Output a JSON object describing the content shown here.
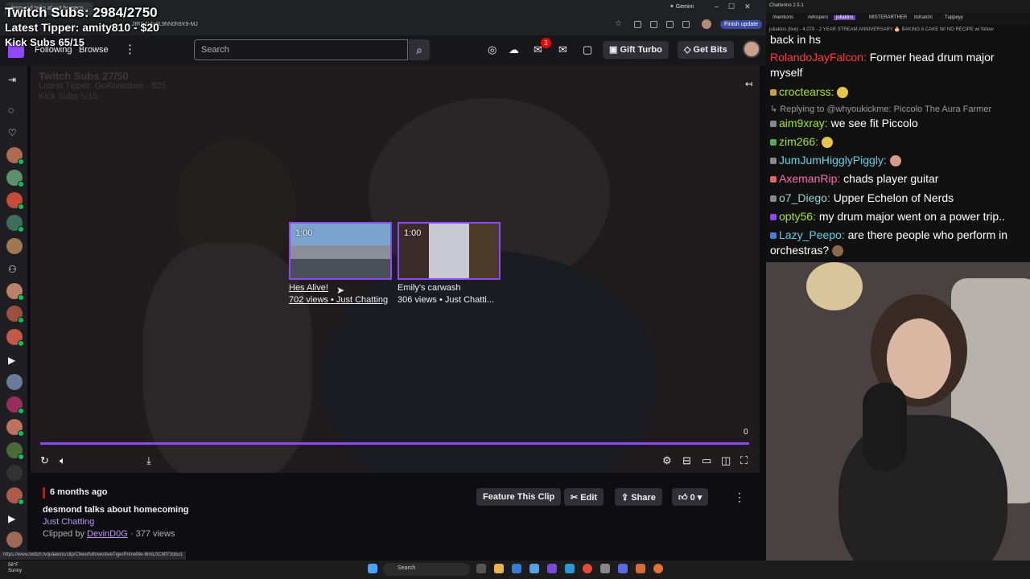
{
  "overlay": {
    "subs": "Twitch Subs: 2984/2750",
    "tipper": "Latest Tipper: amity810 - $20",
    "kick": "Kick Subs 65/15",
    "faded_line1": "Twitch Subs 27/50",
    "faded_line2": "Latest Tipper: GoKonstsee - $25",
    "faded_line3": "Kick Subs 5/15"
  },
  "browser": {
    "tab_title": "desmond talks about homeco...",
    "url": "...JIR8-Nde9L9hN0h9X9-MJ",
    "gemini": "Gemini",
    "finish_update": "Finish update"
  },
  "nav": {
    "following": "Following",
    "browse": "Browse",
    "search_placeholder": "Search",
    "notif_count": "3",
    "gift_turbo": "Gift Turbo",
    "get_bits": "Get Bits"
  },
  "clips": [
    {
      "duration": "1:00",
      "title": "Hes Alive!",
      "meta": "702 views • Just Chatting"
    },
    {
      "duration": "1:00",
      "title": "Emily's carwash",
      "meta": "306 views • Just Chatti..."
    }
  ],
  "player": {
    "time": "0",
    "progress": 1.0
  },
  "clip_info": {
    "time_ago": "6 months ago",
    "title": "desmond talks about homecoming",
    "category": "Just Chatting",
    "clipped_by_prefix": "Clipped by",
    "clipper": "DevinD0G",
    "views": "· 377 views",
    "feature": "Feature This Clip",
    "edit": "Edit",
    "share": "Share",
    "likes": "0"
  },
  "status_url": "https://www.twitch.tv/juliakins/clip/CheerfulInventiveTigerPrimeMe-I6mL0CMf73obu1",
  "chatterino": {
    "title": "Chatterino 2.5.1",
    "tabs": [
      "/mentions",
      "/whispers",
      "juliakins",
      "MISTERARTHER",
      "itsKatchi",
      "Tuppeyy"
    ],
    "header": "juliakins (live) - 4,079 - 2 YEAR STREAM ANNIVERSARY 🎂 BAKING A CAKE W/ NO RECIPE w/",
    "header_follow": "follow",
    "messages": [
      {
        "user": "",
        "text": "back in hs",
        "color": "#ffffff"
      },
      {
        "user": "RolandoJayFalcon:",
        "text": "Former head drum major myself",
        "color": "#ff3c3c"
      },
      {
        "user": "croctearss:",
        "text": "",
        "color": "#a8e61d"
      },
      {
        "user": "",
        "text": "Replying to @whyoukickme: Piccolo The Aura Farmer",
        "color": "#9a9a9a",
        "reply": true
      },
      {
        "user": "aim9xray:",
        "text": "we see fit Piccolo",
        "color": "#a8e61d"
      },
      {
        "user": "zim266:",
        "text": "",
        "color": "#a8e61d"
      },
      {
        "user": "JumJumHigglyPiggly:",
        "text": "",
        "color": "#5fd3e6"
      },
      {
        "user": "AxemanRip:",
        "text": "chads player guitar",
        "color": "#ff69b4"
      },
      {
        "user": "o7_Diego:",
        "text": "Upper Echelon of Nerds",
        "color": "#9ad4d4"
      },
      {
        "user": "opty56:",
        "text": "my drum major went on a power trip..",
        "color": "#a8e61d"
      },
      {
        "user": "Lazy_Peepo:",
        "text": "are there people who perform in orchestras?",
        "color": "#5fd3e6"
      }
    ]
  },
  "taskbar": {
    "temp": "56°F",
    "weather": "Sunny",
    "search": "Search"
  }
}
